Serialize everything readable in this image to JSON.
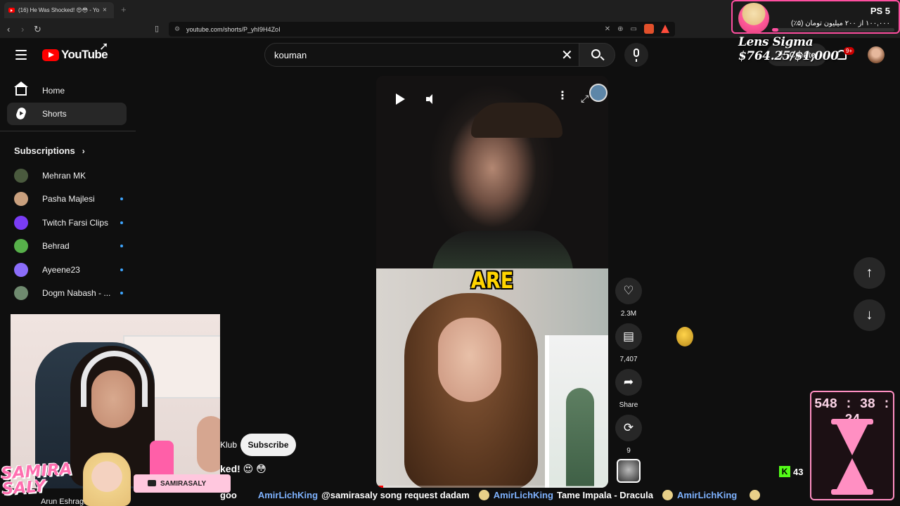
{
  "browser": {
    "tab_title": "(16) He Was Shocked! 😍😳 - Yo",
    "tab_close": "×",
    "new_tab": "+",
    "url": "youtube.com/shorts/P_yhI9H4ZoI",
    "back": "‹",
    "forward": "›",
    "reload": "↻"
  },
  "header": {
    "logo_text": "YouTube",
    "search_value": "kouman",
    "clear_label": "✕",
    "create_label": "Create",
    "notif_count": "9+"
  },
  "sidebar": {
    "items": [
      {
        "label": "Home"
      },
      {
        "label": "Shorts"
      }
    ],
    "subscriptions_label": "Subscriptions",
    "subscriptions": [
      {
        "name": "Mehran MK",
        "color": "#4a5a3e",
        "dot": false
      },
      {
        "name": "Pasha Majlesi",
        "color": "#c9a07e",
        "dot": true
      },
      {
        "name": "Twitch Farsi Clips",
        "color": "#7a3cf5",
        "dot": true
      },
      {
        "name": "Behrad",
        "color": "#57b04a",
        "dot": true
      },
      {
        "name": "Ayeene23",
        "color": "#8b6dfa",
        "dot": true
      },
      {
        "name": "Dogm Nabash - ...",
        "color": "#6f8a6f",
        "dot": true
      }
    ]
  },
  "video": {
    "caption": "ARE",
    "progress": 0.03
  },
  "actions": {
    "likes": "2.3M",
    "comments": "7,407",
    "share": "Share",
    "remix": "9"
  },
  "pip": {
    "channel_fragment": "Klub",
    "subscribe_label": "Subscribe",
    "title_fragment": "ked! 😍 😳",
    "under_text": "Arun Eshragh"
  },
  "overlays": {
    "ps_title": "PS 5",
    "ps_sub": "۱۰۰,۰۰۰ از ۲۰۰ میلیون تومان (۵٪)",
    "ps_progress": 0.05,
    "lens_text": "Lens Sigma $764.25/$1,000",
    "timer": "548 : 38 : 24",
    "kick_count": "43",
    "brand_name_1": "SAMIRA",
    "brand_name_2": "SALY",
    "social_handle": "SAMIRASALY"
  },
  "chat": [
    {
      "user": "",
      "msg": "goo"
    },
    {
      "user": "AmirLichKing",
      "msg": "@samirasaly song request dadam"
    },
    {
      "user": "AmirLichKing",
      "msg": "Tame Impala - Dracula"
    },
    {
      "user": "AmirLichKing",
      "msg": ""
    }
  ]
}
